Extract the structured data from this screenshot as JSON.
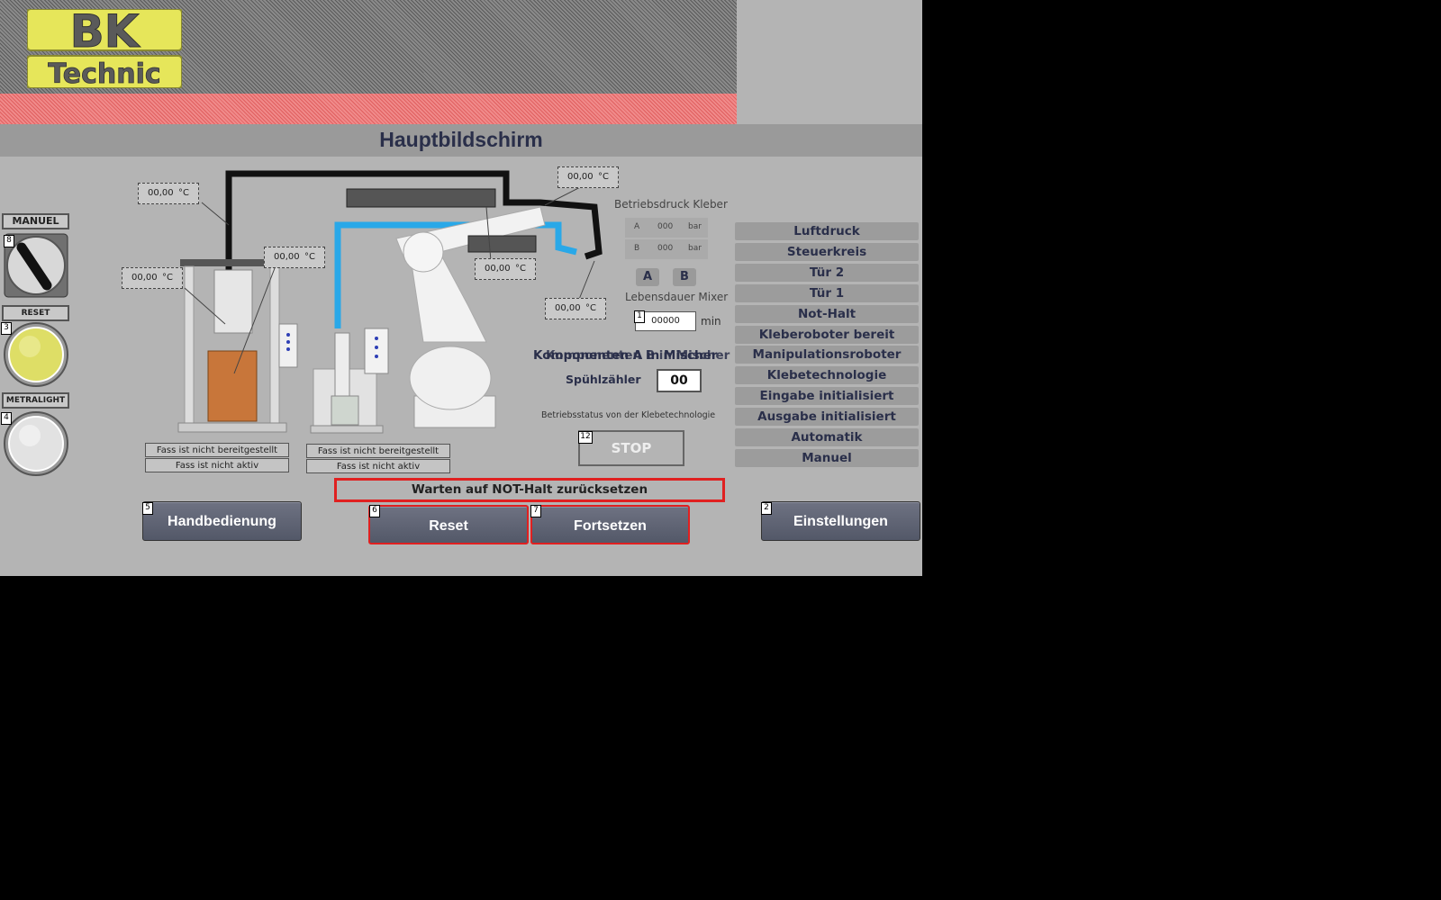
{
  "header": {
    "logo_top": "BK",
    "logo_bottom": "Technic",
    "title": "Hauptbildschirm"
  },
  "left_panel": {
    "mode_label": "MANUEL",
    "mode_number": "8",
    "reset_label": "RESET",
    "reset_number": "3",
    "light_label": "METRALIGHT",
    "light_number": "4"
  },
  "temperatures": {
    "t1": {
      "value": "00,00",
      "unit": "°C"
    },
    "t2": {
      "value": "00,00",
      "unit": "°C"
    },
    "t3": {
      "value": "00,00",
      "unit": "°C"
    },
    "t4": {
      "value": "00,00",
      "unit": "°C"
    },
    "t5": {
      "value": "00,00",
      "unit": "°C"
    },
    "t6": {
      "value": "00,00",
      "unit": "°C"
    }
  },
  "barrels": {
    "left": {
      "status1": "Fass ist nicht bereitgestellt",
      "status2": "Fass ist nicht aktiv"
    },
    "right": {
      "status1": "Fass ist nicht bereitgestellt",
      "status2": "Fass ist nicht aktiv"
    }
  },
  "pressure": {
    "title": "Betriebsdruck Kleber",
    "rows": [
      {
        "label": "A",
        "value": "000",
        "unit": "bar"
      },
      {
        "label": "B",
        "value": "000",
        "unit": "bar"
      }
    ],
    "btn_a": "A",
    "btn_b": "B"
  },
  "mixer": {
    "title": "Lebensdauer Mixer",
    "number": "1",
    "value": "00000",
    "unit": "min",
    "overlap_text": "Komponenten A in Mischer",
    "overlap_text2": "Komponenten B in Mischer",
    "flush_label": "Spühlzähler",
    "flush_value": "00"
  },
  "operation": {
    "status_title": "Betriebsstatus von der Klebetechnologie",
    "number": "12",
    "state": "STOP"
  },
  "status_list": [
    "Luftdruck",
    "Steuerkreis",
    "Tür 2",
    "Tür 1",
    "Not-Halt",
    "Kleberoboter bereit",
    "Manipulationsroboter bereit",
    "Klebetechnologie",
    "Eingabe initialisiert",
    "Ausgabe initialisiert",
    "Automatik",
    "Manuel"
  ],
  "message": "Warten auf NOT-Halt zurücksetzen",
  "buttons": {
    "manual": {
      "label": "Handbedienung",
      "number": "5"
    },
    "reset": {
      "label": "Reset",
      "number": "6"
    },
    "continue": {
      "label": "Fortsetzen",
      "number": "7"
    },
    "settings": {
      "label": "Einstellungen",
      "number": "2"
    }
  },
  "colors": {
    "background": "#b4b4b4",
    "title_text": "#2a2f4a",
    "alert_border": "#e02020",
    "logo_yellow": "#e6e65a",
    "reset_lamp": "#dede66",
    "blue_hose": "#29a8e8"
  }
}
